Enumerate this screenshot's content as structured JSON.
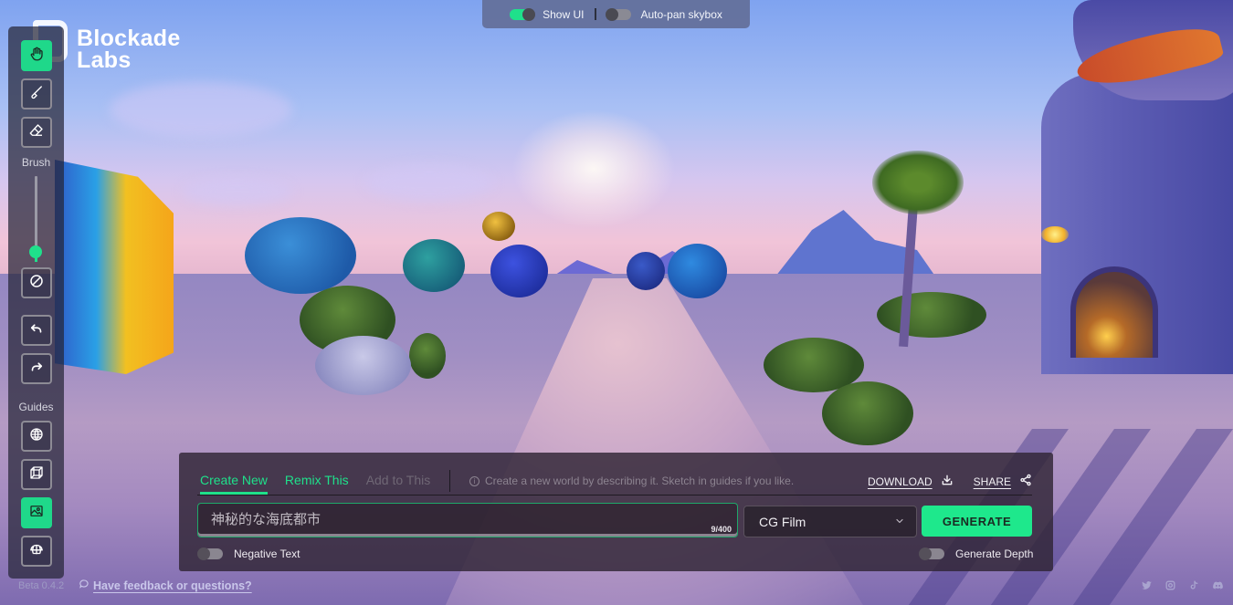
{
  "app": {
    "brand_line1": "Blockade",
    "brand_line2": "Labs",
    "version": "Beta 0.4.2",
    "feedback_link": "Have feedback or questions?"
  },
  "topbar": {
    "show_ui": {
      "label": "Show UI",
      "enabled": true
    },
    "auto_pan": {
      "label": "Auto-pan skybox",
      "enabled": false
    }
  },
  "toolbar": {
    "brush_label": "Brush",
    "guides_label": "Guides",
    "brush_size": 0.08,
    "tools": [
      {
        "name": "pan",
        "icon": "hand-icon",
        "active": true
      },
      {
        "name": "brush",
        "icon": "brush-icon",
        "active": false
      },
      {
        "name": "eraser",
        "icon": "eraser-icon",
        "active": false
      },
      {
        "name": "clear",
        "icon": "no-entry-icon",
        "active": false
      },
      {
        "name": "undo",
        "icon": "undo-icon",
        "active": false
      },
      {
        "name": "redo",
        "icon": "redo-icon",
        "active": false
      }
    ],
    "guides": [
      {
        "name": "globe",
        "icon": "globe-icon",
        "active": false
      },
      {
        "name": "cube",
        "icon": "cube-icon",
        "active": false
      },
      {
        "name": "image",
        "icon": "image-icon",
        "active": true
      },
      {
        "name": "dome",
        "icon": "dome-icon",
        "active": false
      }
    ]
  },
  "panel": {
    "tabs": [
      {
        "label": "Create New",
        "state": "active"
      },
      {
        "label": "Remix This",
        "state": "enabled"
      },
      {
        "label": "Add to This",
        "state": "disabled"
      }
    ],
    "hint": "Create a new world by describing it. Sketch in guides if you like.",
    "download_label": "DOWNLOAD",
    "share_label": "SHARE",
    "prompt_value": "神秘的な海底都市",
    "prompt_counter": "9/400",
    "style_selected": "CG Film",
    "generate_label": "GENERATE",
    "negative_text": {
      "label": "Negative Text",
      "enabled": false
    },
    "generate_depth": {
      "label": "Generate Depth",
      "enabled": false
    }
  },
  "socials": [
    "twitter-icon",
    "instagram-icon",
    "tiktok-icon",
    "discord-icon"
  ],
  "colors": {
    "accent": "#1fe08b",
    "panel_bg": "#30243 4",
    "toolbar_bg": "#262638"
  }
}
